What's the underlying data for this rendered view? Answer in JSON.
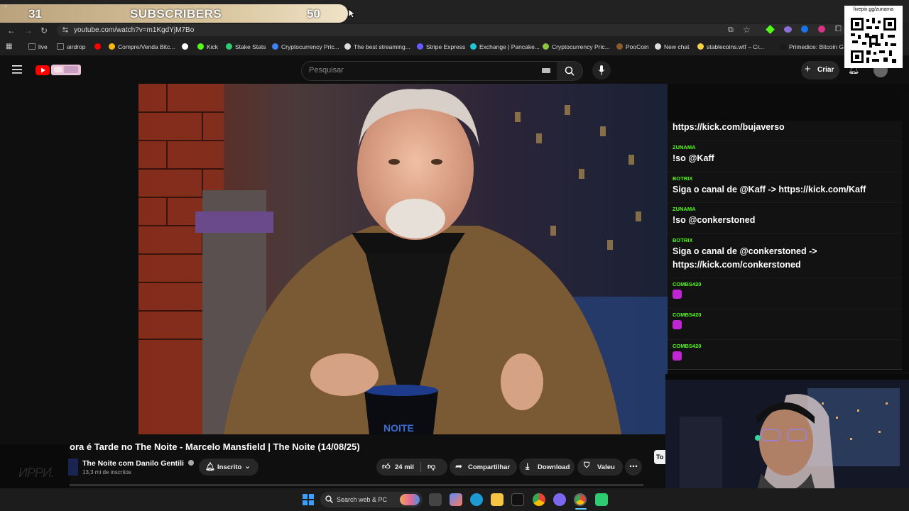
{
  "subscriber_goal": {
    "current": "31",
    "label": "SUBSCRIBERS",
    "goal": "50",
    "progress_fraction": 0.62,
    "fill_color": "#d8c49c"
  },
  "browser": {
    "url": "youtube.com/watch?v=m1KgdYjM7Bo",
    "bookmarks": [
      {
        "label": "live",
        "icon": "folder-icon",
        "color": "#888888"
      },
      {
        "label": "airdrop",
        "icon": "folder-icon",
        "color": "#888888"
      },
      {
        "label": "",
        "icon": "youtube-icon",
        "color": "#ff0000"
      },
      {
        "label": "Compre/Venda Bitc...",
        "icon": "binance-icon",
        "color": "#f0b90b"
      },
      {
        "label": "",
        "icon": "stake-icon",
        "color": "#ffffff"
      },
      {
        "label": "Kick",
        "icon": "kick-icon",
        "color": "#53fc18"
      },
      {
        "label": "Stake Stats",
        "icon": "stats-icon",
        "color": "#2ecc71"
      },
      {
        "label": "Cryptocurrency Pric...",
        "icon": "coin-icon",
        "color": "#3b82f6"
      },
      {
        "label": "The best streaming...",
        "icon": "stream-icon",
        "color": "#dddddd"
      },
      {
        "label": "Stripe Express",
        "icon": "stripe-icon",
        "color": "#635bff"
      },
      {
        "label": "Exchange | Pancake...",
        "icon": "pancake-icon",
        "color": "#1fc7d4"
      },
      {
        "label": "Cryptocurrency Pric...",
        "icon": "coin-icon",
        "color": "#8dc63f"
      },
      {
        "label": "PooCoin",
        "icon": "poocoin-icon",
        "color": "#8b5a2b"
      },
      {
        "label": "New chat",
        "icon": "chatgpt-icon",
        "color": "#dddddd"
      },
      {
        "label": "stablecoins.wtf – Cr...",
        "icon": "stablecoin-icon",
        "color": "#f7d046"
      },
      {
        "label": "Primedice: Bitcoin G...",
        "icon": "dice-icon",
        "color": "#1a1a1a"
      }
    ]
  },
  "youtube": {
    "search_placeholder": "Pesquisar",
    "create_label": "Criar",
    "video_title": "ora é Tarde no The Noite - Marcelo Mansfield | The Noite (14/08/25)",
    "channel_name": "The Noite com Danilo Gentili",
    "channel_subs": "13,3 mi de inscritos",
    "subscribed_label": "Inscrito",
    "likes": "24 mil",
    "share_label": "Compartilhar",
    "download_label": "Download",
    "thanks_label": "Valeu",
    "video_overlay_logo": "NOITE"
  },
  "chat": {
    "messages": [
      {
        "user": "",
        "text": "https://kick.com/bujaverso",
        "color": "#53fc18"
      },
      {
        "user": "ZUNAMA",
        "text": "!so @Kaff",
        "color": "#53fc18"
      },
      {
        "user": "BOTRIX",
        "text": "Siga o canal de @Kaff -> https://kick.com/Kaff",
        "color": "#53fc18"
      },
      {
        "user": "ZUNAMA",
        "text": "!so @conkerstoned",
        "color": "#53fc18"
      },
      {
        "user": "BOTRIX",
        "text": "Siga o canal de @conkerstoned -> https://kick.com/conkerstoned",
        "color": "#53fc18"
      },
      {
        "user": "COMBS420",
        "text": "",
        "color": "#53fc18",
        "emote": true
      },
      {
        "user": "COMBS420",
        "text": "",
        "color": "#53fc18",
        "emote": true
      },
      {
        "user": "COMBS420",
        "text": "",
        "color": "#53fc18",
        "emote": true
      }
    ]
  },
  "overlay": {
    "livepix_url": "livepix.gg/zunama",
    "watermark": "ИPPИ.",
    "side_tab": "To"
  },
  "taskbar": {
    "search_placeholder": "Search web & PC"
  }
}
